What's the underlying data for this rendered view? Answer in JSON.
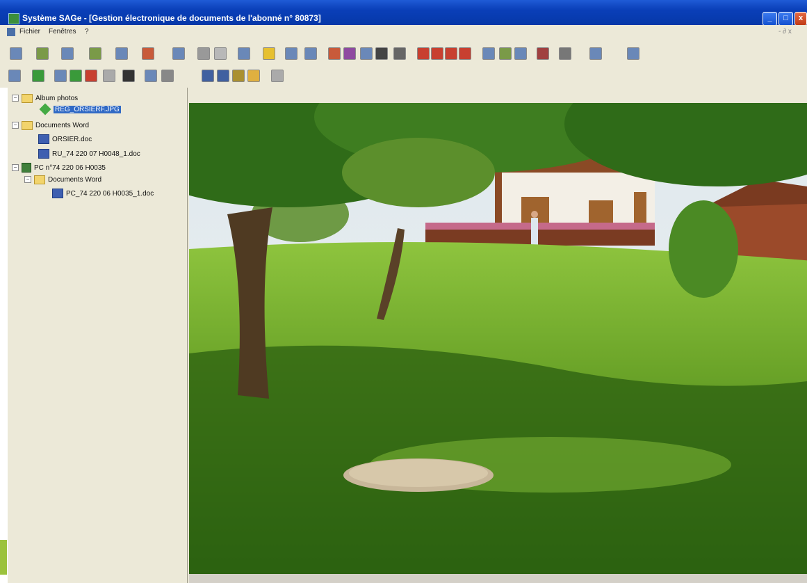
{
  "window": {
    "title": "Système SAGe - [Gestion électronique de documents de l'abonné n° 80873]",
    "minimize_glyph": "_",
    "maximize_glyph": "□",
    "close_glyph": "x"
  },
  "menu": {
    "items": [
      "Fichier",
      "Fenêtres",
      "?"
    ],
    "mdi_controls": "- ∂ x"
  },
  "tree": {
    "nodes": [
      {
        "label": "Album photos",
        "type": "folder",
        "expander": "−"
      },
      {
        "label": "REG_ORSIERF.JPG",
        "type": "image",
        "selected": true
      },
      {
        "label": "Documents Word",
        "type": "folder",
        "expander": "−"
      },
      {
        "label": "ORSIER.doc",
        "type": "doc"
      },
      {
        "label": "RU_74 220 07 H0048_1.doc",
        "type": "doc"
      },
      {
        "label": "PC n°74 220 06 H0035",
        "type": "pc",
        "expander": "−"
      },
      {
        "label": "Documents Word",
        "type": "folder",
        "expander": "−"
      },
      {
        "label": "PC_74 220 06 H0035_1.doc",
        "type": "doc"
      }
    ]
  },
  "viewer": {
    "image_subject": "garden-lawn-with-tree-and-house-photo"
  },
  "colors": {
    "titlebar": "#0a3fb8",
    "selection": "#316ac5",
    "chrome": "#ece9d8"
  }
}
